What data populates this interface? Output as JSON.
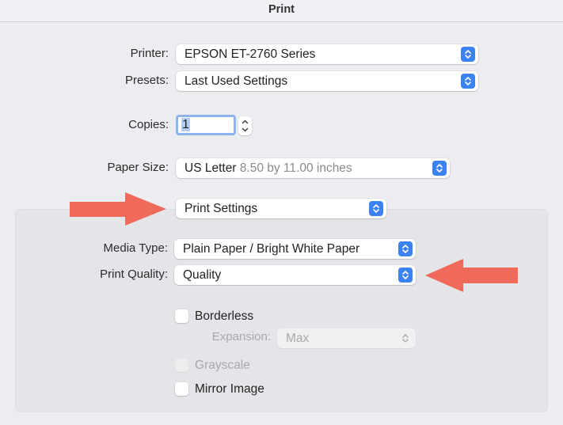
{
  "window": {
    "title": "Print"
  },
  "printer": {
    "label": "Printer:",
    "value": "EPSON ET-2760 Series",
    "icon": "popup-stepper-icon"
  },
  "presets": {
    "label": "Presets:",
    "value": "Last Used Settings",
    "icon": "popup-stepper-icon"
  },
  "copies": {
    "label": "Copies:",
    "value": "1",
    "icon": "stepper-up-down-icon"
  },
  "paper_size": {
    "label": "Paper Size:",
    "value": "US Letter",
    "detail": "8.50 by 11.00 inches",
    "icon": "popup-stepper-icon"
  },
  "section": {
    "value": "Print Settings",
    "icon": "popup-stepper-icon"
  },
  "media_type": {
    "label": "Media Type:",
    "value": "Plain Paper / Bright White Paper",
    "icon": "popup-stepper-icon"
  },
  "print_quality": {
    "label": "Print Quality:",
    "value": "Quality",
    "icon": "popup-stepper-icon"
  },
  "options": {
    "borderless": {
      "label": "Borderless",
      "checked": false,
      "enabled": true
    },
    "expansion": {
      "label": "Expansion:",
      "value": "Max",
      "enabled": false
    },
    "grayscale": {
      "label": "Grayscale",
      "checked": false,
      "enabled": false
    },
    "mirror_image": {
      "label": "Mirror Image",
      "checked": false,
      "enabled": true
    }
  },
  "annotations": {
    "arrow_color": "#f06a5c",
    "arrows": [
      {
        "name": "arrow-right",
        "points_to": "Print Settings"
      },
      {
        "name": "arrow-left",
        "points_to": "Print Quality"
      }
    ]
  },
  "colors": {
    "accent": "#3b82f2",
    "focus_ring": "#8fb2f0",
    "panel_bg": "#e4e5e8",
    "window_bg": "#ecedf0"
  }
}
